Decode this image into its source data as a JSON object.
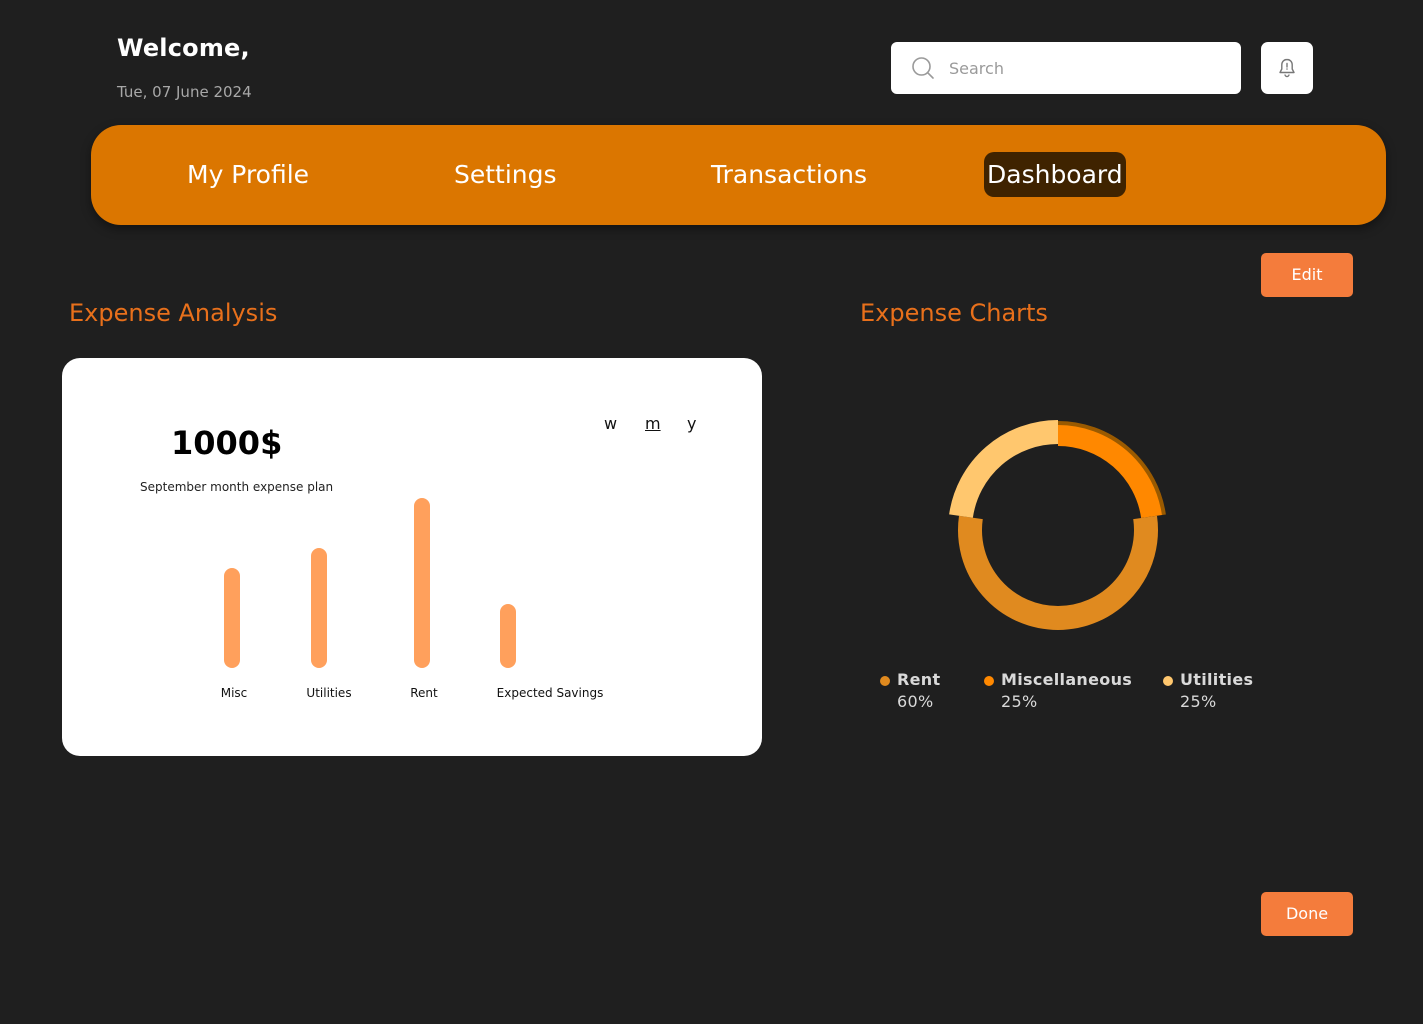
{
  "header": {
    "welcome": "Welcome,",
    "date": "Tue, 07 June 2024",
    "search_placeholder": "Search"
  },
  "nav": {
    "items": [
      "My Profile",
      "Settings",
      "Transactions",
      "Dashboard"
    ],
    "active": "Dashboard"
  },
  "buttons": {
    "edit": "Edit",
    "done": "Done"
  },
  "analysis": {
    "title": "Expense Analysis",
    "amount": "1000$",
    "caption": "September month expense plan",
    "periods": [
      "w",
      "m",
      "y"
    ],
    "selected_period": "m"
  },
  "charts": {
    "title": "Expense Charts",
    "legend": [
      {
        "name": "Rent",
        "pct": "60%",
        "color": "#e08a1f"
      },
      {
        "name": "Miscellaneous",
        "pct": "25%",
        "color": "#ff8800"
      },
      {
        "name": "Utilities",
        "pct": "25%",
        "color": "#ffc76e"
      }
    ]
  },
  "chart_data": [
    {
      "type": "bar",
      "categories": [
        "Misc",
        "Utilities",
        "Rent",
        "Expected Savings"
      ],
      "values": [
        100,
        120,
        170,
        64
      ],
      "bar_color": "#ffa05c"
    },
    {
      "type": "pie",
      "categories": [
        "Rent",
        "Miscellaneous",
        "Utilities"
      ],
      "values": [
        60,
        25,
        25
      ],
      "colors": [
        "#e08a1f",
        "#ff8800",
        "#ffc76e"
      ]
    }
  ],
  "colors": {
    "background": "#1f1f1f",
    "nav": "#db7600",
    "nav_active": "#3f2300",
    "accent_text": "#e8701b",
    "button": "#f47c3c"
  }
}
